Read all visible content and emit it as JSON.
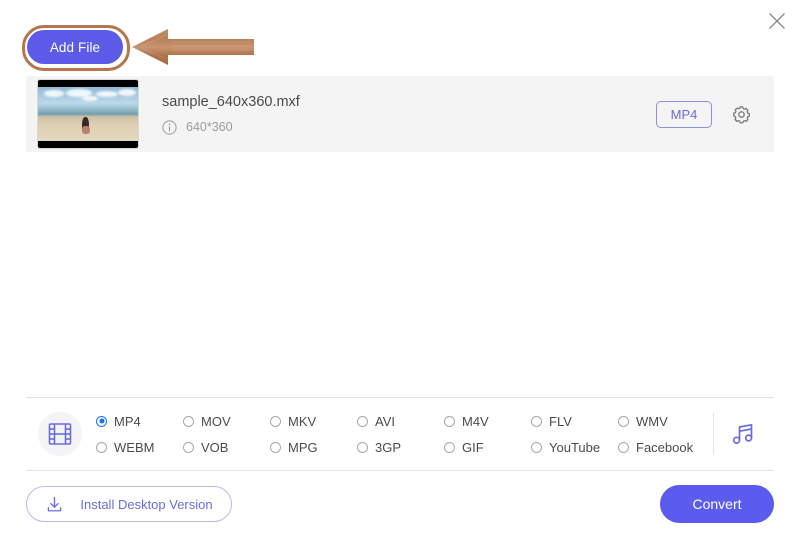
{
  "window": {
    "close_label": "×"
  },
  "toolbar": {
    "add_file_label": "Add File"
  },
  "annotation": {
    "ring_color": "#b5764c",
    "arrow_color": "#b5764c",
    "arrow_direction": "left"
  },
  "file_list": {
    "items": [
      {
        "name": "sample_640x360.mxf",
        "resolution": "640*360",
        "output_format": "MP4",
        "thumbnail_alt": "beach-scene-thumbnail"
      }
    ]
  },
  "format_bar": {
    "media_type_icon": "film-strip-icon",
    "audio_icon": "music-note-icon",
    "selected": "MP4",
    "options": [
      "MP4",
      "MOV",
      "MKV",
      "AVI",
      "M4V",
      "FLV",
      "WMV",
      "WEBM",
      "VOB",
      "MPG",
      "3GP",
      "GIF",
      "YouTube",
      "Facebook"
    ]
  },
  "footer": {
    "install_label": "Install Desktop Version",
    "convert_label": "Convert"
  },
  "colors": {
    "accent": "#5b5bee",
    "accent_text": "#6b6be0",
    "radio_selected": "#1a73e8",
    "row_bg": "#f4f4f5"
  }
}
